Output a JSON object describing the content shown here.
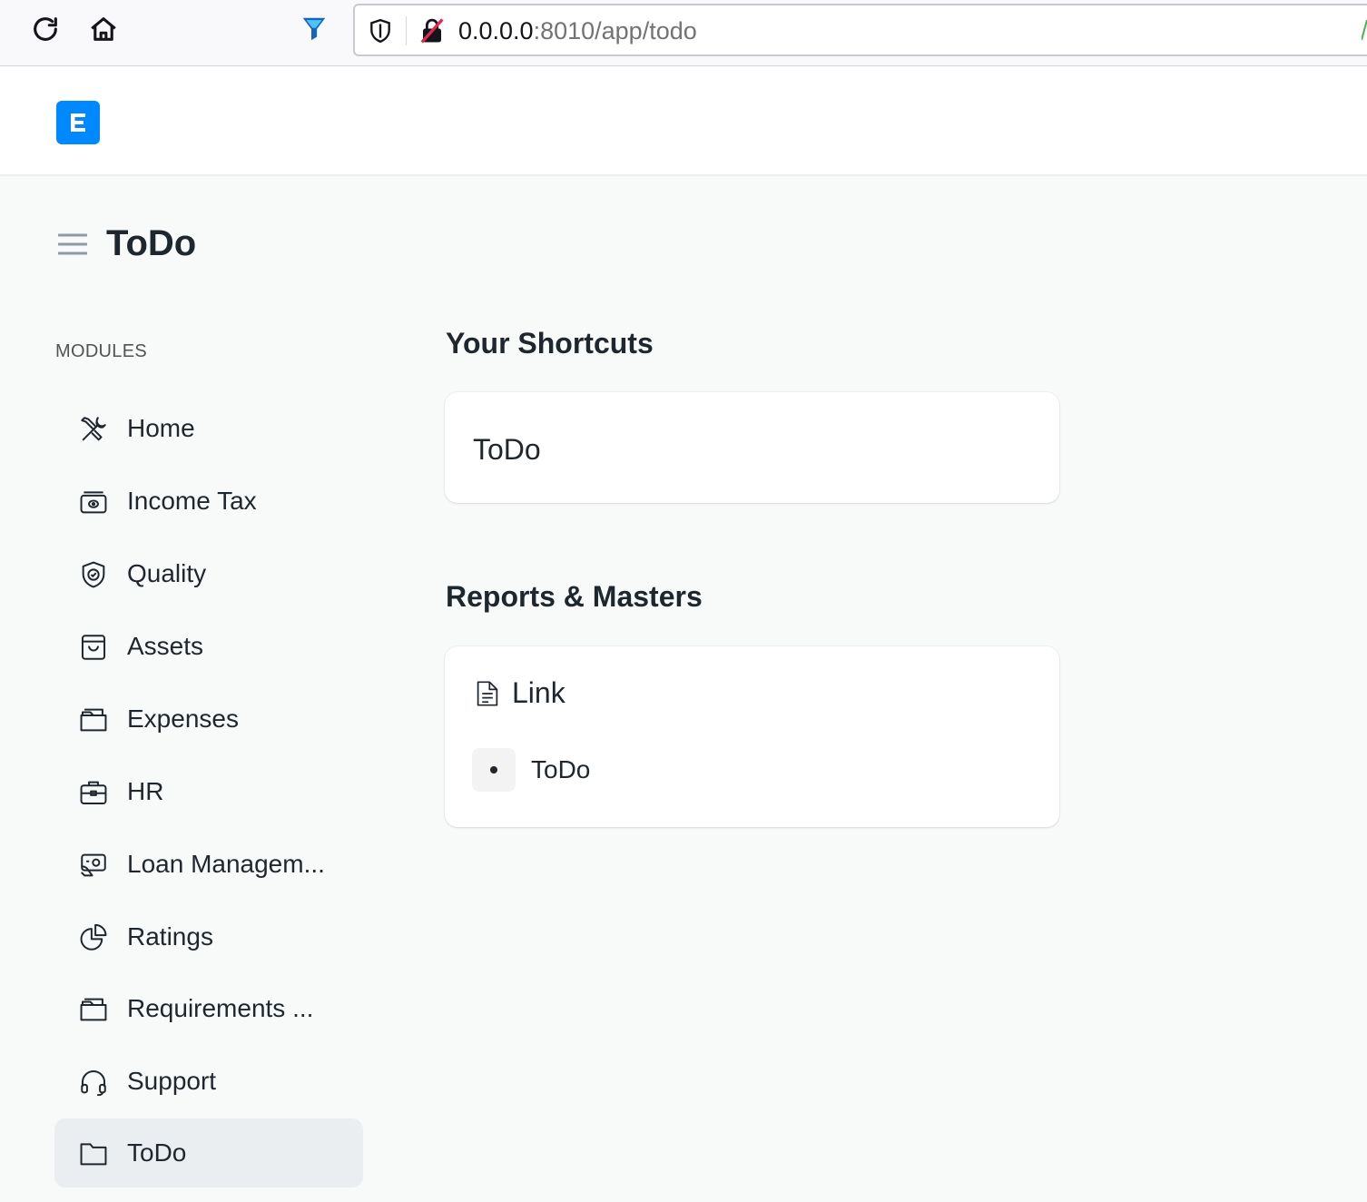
{
  "browser": {
    "url_host": "0.0.0.0",
    "url_path": ":8010/app/todo"
  },
  "app": {
    "logo_letter": "E",
    "brand_color": "#0089ff"
  },
  "page": {
    "title": "ToDo"
  },
  "sidebar": {
    "section_label": "MODULES",
    "items": [
      {
        "label": "Home",
        "icon": "tools-icon"
      },
      {
        "label": "Income Tax",
        "icon": "money-icon"
      },
      {
        "label": "Quality",
        "icon": "shield-check-icon"
      },
      {
        "label": "Assets",
        "icon": "shopping-bag-icon"
      },
      {
        "label": "Expenses",
        "icon": "folder-open-icon"
      },
      {
        "label": "HR",
        "icon": "briefcase-icon"
      },
      {
        "label": "Loan Managem...",
        "icon": "hand-money-icon"
      },
      {
        "label": "Ratings",
        "icon": "pie-chart-icon"
      },
      {
        "label": "Requirements ...",
        "icon": "folder-open-icon"
      },
      {
        "label": "Support",
        "icon": "headset-icon"
      },
      {
        "label": "ToDo",
        "icon": "folder-icon",
        "active": true
      }
    ]
  },
  "shortcuts": {
    "title": "Your Shortcuts",
    "items": [
      {
        "label": "ToDo"
      }
    ]
  },
  "reports": {
    "title": "Reports & Masters",
    "card_title": "Link",
    "card_icon": "file-text-icon",
    "links": [
      {
        "label": "ToDo"
      }
    ]
  }
}
